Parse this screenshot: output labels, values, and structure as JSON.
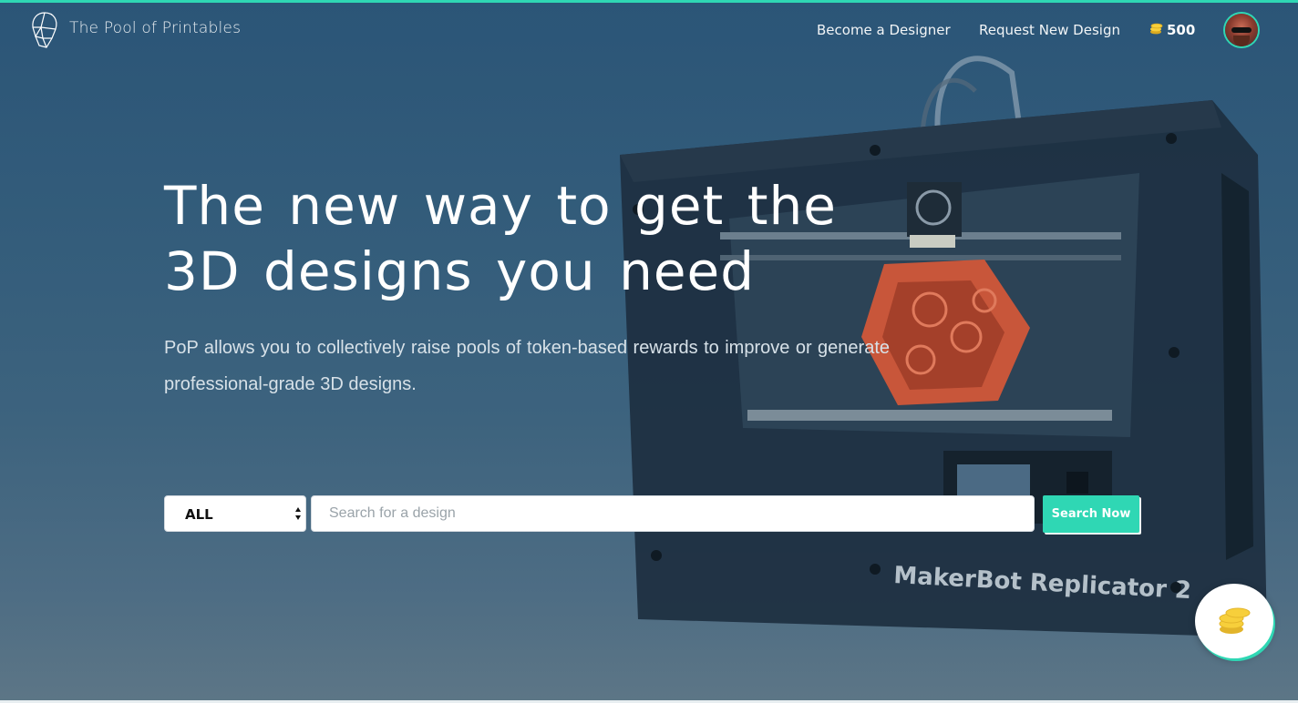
{
  "header": {
    "brand_name": "The Pool of Printables",
    "logo_icon": "geometric-head-logo",
    "nav": {
      "become_designer": "Become a Designer",
      "request_design": "Request New Design"
    },
    "token_balance": "500",
    "token_icon": "coins-icon",
    "avatar_alt": "user-avatar"
  },
  "hero": {
    "title": "The new way to get the 3D designs you need",
    "subtitle": "PoP allows you to collectively raise pools of token-based rewards to improve or generate professional-grade 3D designs.",
    "background_text": "MakerBot Replicator 2"
  },
  "search": {
    "category_selected": "ALL",
    "placeholder": "Search for a design",
    "value": "",
    "button_label": "Search Now"
  },
  "fab": {
    "icon": "coins-stack-icon"
  },
  "colors": {
    "accent": "#2fd7b4",
    "coin": "#f7cf3b",
    "hero_bg": "#2b5577"
  }
}
